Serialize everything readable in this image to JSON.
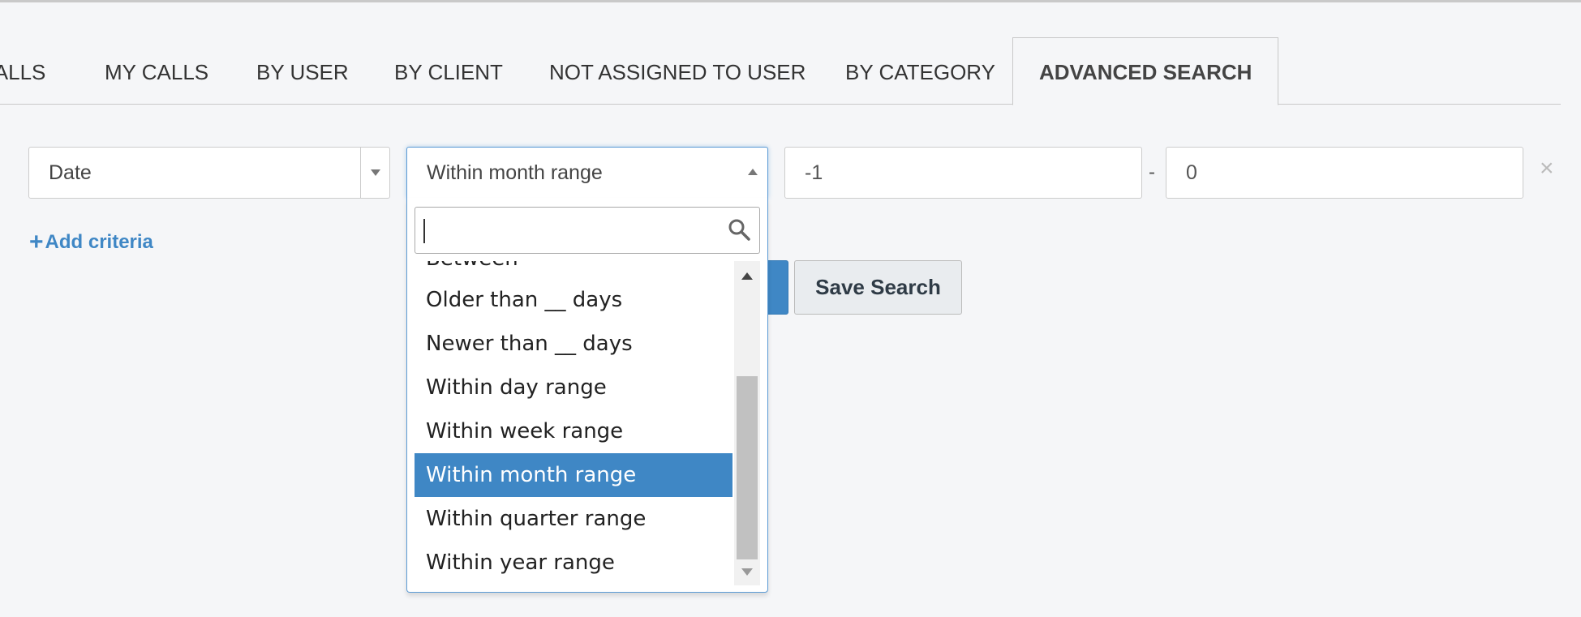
{
  "tabs": [
    {
      "label": "CALLS"
    },
    {
      "label": "MY CALLS"
    },
    {
      "label": "BY USER"
    },
    {
      "label": "BY CLIENT"
    },
    {
      "label": "NOT ASSIGNED TO USER"
    },
    {
      "label": "BY CATEGORY"
    },
    {
      "label": "ADVANCED SEARCH",
      "active": true
    }
  ],
  "criteria": {
    "field_value": "Date",
    "operator_value": "Within month range",
    "range_from": "-1",
    "range_separator": "-",
    "range_to": "0",
    "remove_glyph": "×",
    "remove_icon": "close-icon"
  },
  "add_criteria": {
    "icon_glyph": "+",
    "label": "Add criteria"
  },
  "buttons": {
    "save_search": "Save Search",
    "primary_color": "#3f87c5"
  },
  "operator_dropdown": {
    "search_value": "",
    "search_icon": "search-icon",
    "options": [
      {
        "label": "Between"
      },
      {
        "label": "Older than __ days"
      },
      {
        "label": "Newer than __ days"
      },
      {
        "label": "Within day range"
      },
      {
        "label": "Within week range"
      },
      {
        "label": "Within month range",
        "selected": true
      },
      {
        "label": "Within quarter range"
      },
      {
        "label": "Within year range"
      }
    ]
  }
}
